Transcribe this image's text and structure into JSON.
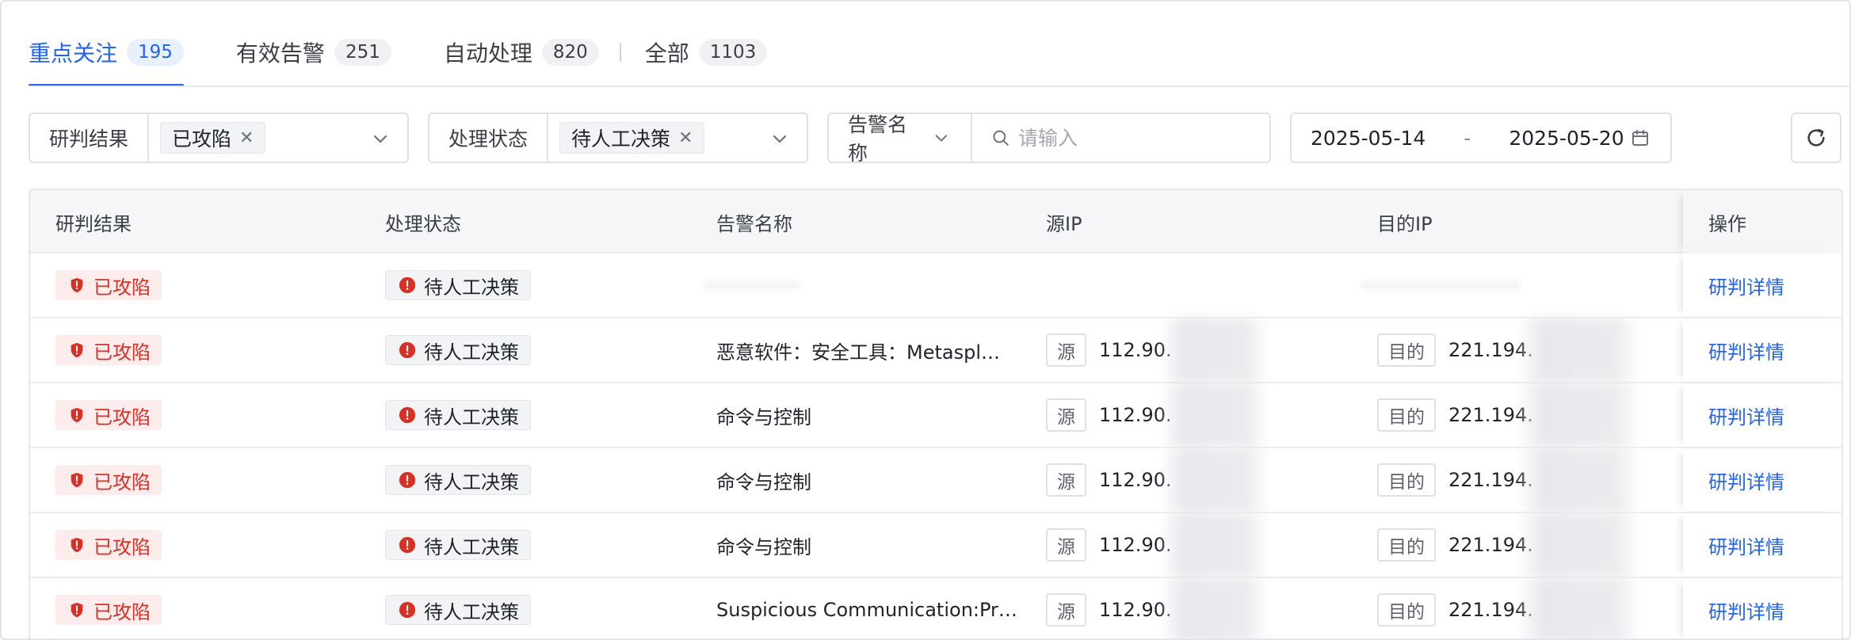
{
  "tabs": [
    {
      "label": "重点关注",
      "count": "195"
    },
    {
      "label": "有效告警",
      "count": "251"
    },
    {
      "label": "自动处理",
      "count": "820"
    },
    {
      "label": "全部",
      "count": "1103"
    }
  ],
  "filters": {
    "result": {
      "label": "研判结果",
      "chip": "已攻陷"
    },
    "status": {
      "label": "处理状态",
      "chip": "待人工决策"
    },
    "search": {
      "field": "告警名称",
      "placeholder": "请输入"
    },
    "date": {
      "start": "2025-05-14",
      "sep": "-",
      "end": "2025-05-20"
    }
  },
  "table": {
    "headers": {
      "result": "研判结果",
      "status": "处理状态",
      "name": "告警名称",
      "src": "源IP",
      "dst": "目的IP",
      "op": "操作"
    },
    "src_tag": "源",
    "dst_tag": "目的",
    "rows": [
      {
        "result": "已攻陷",
        "status": "待人工决策",
        "name": "",
        "src_ip": "",
        "dst_ip": "",
        "action": "研判详情"
      },
      {
        "result": "已攻陷",
        "status": "待人工决策",
        "name": "恶意软件：安全工具：Metaspl…",
        "src_ip": "112.90.",
        "dst_ip": "221.194.",
        "action": "研判详情"
      },
      {
        "result": "已攻陷",
        "status": "待人工决策",
        "name": "命令与控制",
        "src_ip": "112.90.",
        "dst_ip": "221.194.",
        "action": "研判详情"
      },
      {
        "result": "已攻陷",
        "status": "待人工决策",
        "name": "命令与控制",
        "src_ip": "112.90.",
        "dst_ip": "221.194.",
        "action": "研判详情"
      },
      {
        "result": "已攻陷",
        "status": "待人工决策",
        "name": "命令与控制",
        "src_ip": "112.90.",
        "dst_ip": "221.194.",
        "action": "研判详情"
      },
      {
        "result": "已攻陷",
        "status": "待人工决策",
        "name": "Suspicious Communication:Pr…",
        "src_ip": "112.90.",
        "dst_ip": "221.194.",
        "action": "研判详情"
      }
    ]
  },
  "colors": {
    "accent": "#2463eb",
    "danger": "#d93026",
    "danger_bg": "#fdecec"
  },
  "icons": {
    "result_tag": "shield-alert-icon",
    "status_tag": "alert-circle-icon",
    "dropdown": "chevron-down-icon",
    "search": "search-icon",
    "date": "calendar-icon",
    "refresh": "refresh-icon",
    "chip_remove": "close-icon"
  }
}
